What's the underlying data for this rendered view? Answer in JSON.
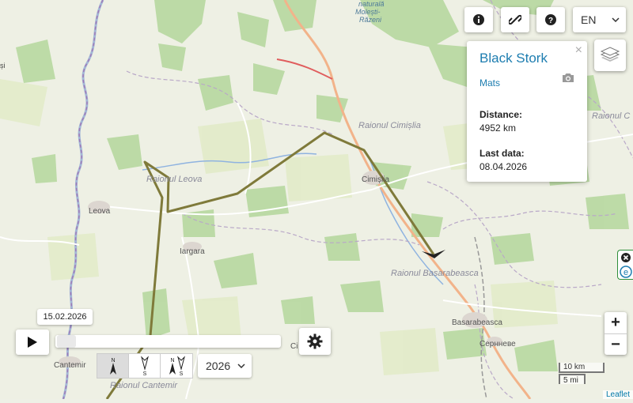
{
  "map": {
    "towns": [
      "Leova",
      "Iargara",
      "Cimișlia",
      "Basarabeasca",
      "Cantemir",
      "Сернневе",
      "Ci"
    ],
    "regions": [
      "Raionul Leova",
      "Raionul Cimișlia",
      "Raionul Basarabeasca",
      "Raionul Cantemir",
      "Raionul C"
    ],
    "water_labels": [
      "naturală",
      "Molești-",
      "Răzeni"
    ],
    "track_color": "#7f7a3a",
    "edge_label": "și"
  },
  "toolbar": {
    "info_icon": "info-circle-icon",
    "link_icon": "link-icon",
    "help_icon": "question-circle-icon",
    "language": "EN"
  },
  "popup": {
    "title": "Black Stork",
    "name": "Mats",
    "distance_label": "Distance:",
    "distance_value": "4952 km",
    "lastdata_label": "Last data:",
    "lastdata_value": "08.04.2026",
    "close": "×"
  },
  "playback": {
    "date": "15.02.2026",
    "year": "2026",
    "slider_fraction": 0.0
  },
  "orientation": {
    "north_label": "N",
    "south_label": "S"
  },
  "zoom": {
    "in": "+",
    "out": "−"
  },
  "scale": {
    "km": "10 km",
    "mi": "5 mi"
  },
  "attribution": "Leaflet"
}
